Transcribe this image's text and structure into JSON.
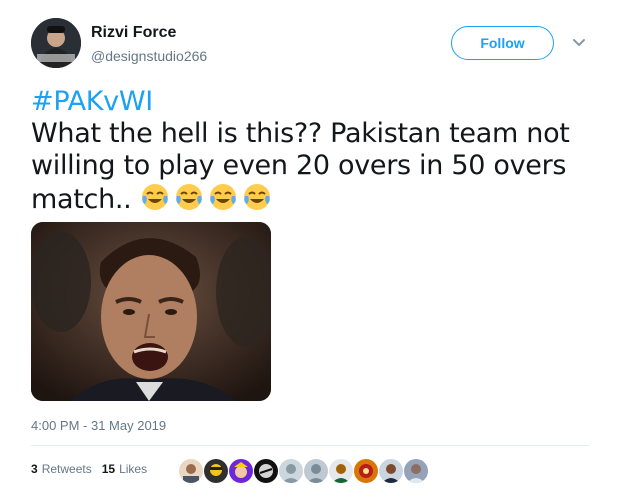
{
  "author": {
    "name": "Rizvi Force",
    "handle": "@designstudio266"
  },
  "follow_button": "Follow",
  "tweet": {
    "hashtag": "#PAKvWI",
    "text": "What the hell is this?? Pakistan team not willing to play even 20 overs in 50 overs match.. ",
    "emoji": [
      "face-with-tears-of-joy",
      "face-with-tears-of-joy",
      "face-with-tears-of-joy",
      "face-with-tears-of-joy"
    ]
  },
  "timestamp": "4:00 PM - 31 May 2019",
  "stats": {
    "retweets_count": "3",
    "retweets_label": "Retweets",
    "likes_count": "15",
    "likes_label": "Likes"
  },
  "colors": {
    "accent": "#1da1f2",
    "text": "#14171a",
    "muted": "#657786",
    "divider": "#e6ecf0"
  },
  "icons": {
    "menu": "chevron-down-icon"
  }
}
